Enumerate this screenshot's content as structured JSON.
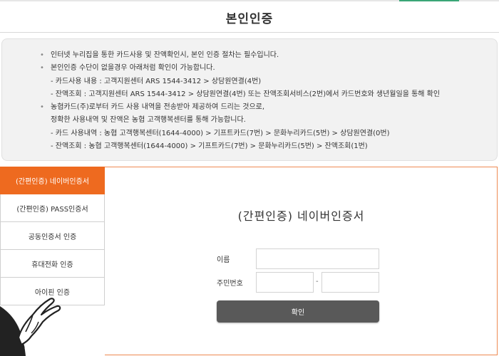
{
  "header": {
    "title": "본인인증"
  },
  "notice": {
    "lines": [
      {
        "type": "bullet",
        "text": "인터넷 누리집을 통한 카드사용 및 잔액확인시, 본인 인증 절차는 필수입니다."
      },
      {
        "type": "bullet",
        "text": "본인인증 수단이 없을경우 아래처럼 확인이 가능합니다."
      },
      {
        "type": "sub",
        "text": "- 카드사용 내용 : 고객지원센터 ARS 1544-3412 > 상담원연결(4번)"
      },
      {
        "type": "sub",
        "text": "- 잔액조회 : 고객지원센터 ARS 1544-3412 > 상담원연결(4번) 또는 잔액조회서비스(2번)에서 카드번호와 생년월일을 통해 확인"
      },
      {
        "type": "bullet",
        "text": "농협카드(주)로부터 카드 사용 내역을 전송받아 제공하여 드리는 것으로,"
      },
      {
        "type": "sub",
        "text": "정확한 사용내역 및 잔액은 농협 고객행복센터를 통해 가능합니다."
      },
      {
        "type": "sub",
        "text": "- 카드 사용내역 : 농협 고객행복센터(1644-4000) > 기프트카드(7번) > 문화누리카드(5번) > 상담원연결(0번)"
      },
      {
        "type": "sub",
        "text": "- 잔액조회 : 농협 고객행복센터(1644-4000) > 기프트카드(7번) > 문화누리카드(5번) > 잔액조회(1번)"
      }
    ]
  },
  "tabs": [
    {
      "label": "(간편인증) 네이버인증서",
      "active": true
    },
    {
      "label": "(간편인증) PASS인증서",
      "active": false
    },
    {
      "label": "공동인증서 인증",
      "active": false
    },
    {
      "label": "휴대전화 인증",
      "active": false
    },
    {
      "label": "아이핀 인증",
      "active": false
    }
  ],
  "form": {
    "title": "(간편인증) 네이버인증서",
    "name_label": "이름",
    "name_value": "",
    "rrn_label": "주민번호",
    "rrn_front_value": "",
    "rrn_back_value": "",
    "rrn_separator": "-",
    "confirm_label": "확인"
  },
  "colors": {
    "accent": "#ee6a1f",
    "button": "#595959",
    "notice_bg": "#f2f2f2"
  }
}
